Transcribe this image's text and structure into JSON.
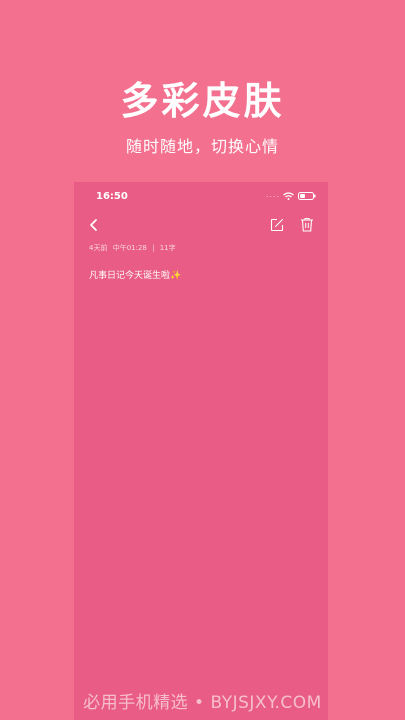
{
  "hero": {
    "title": "多彩皮肤",
    "subtitle": "随时随地，切换心情"
  },
  "status_bar": {
    "time": "16:50",
    "signal_dots": "....",
    "icons": [
      "wifi-icon",
      "battery-icon"
    ]
  },
  "toolbar": {
    "icons": [
      "back-icon",
      "edit-icon",
      "trash-icon"
    ]
  },
  "note": {
    "relative_time": "4天前",
    "time": "中午01:28",
    "separator": "|",
    "char_count": "11字",
    "body": "凡事日记今天诞生啦✨"
  },
  "watermark": "必用手机精选 • BYJSJXY.COM",
  "colors": {
    "background": "#f4708f",
    "phone_background": "#e95c85",
    "text": "#ffffff"
  }
}
